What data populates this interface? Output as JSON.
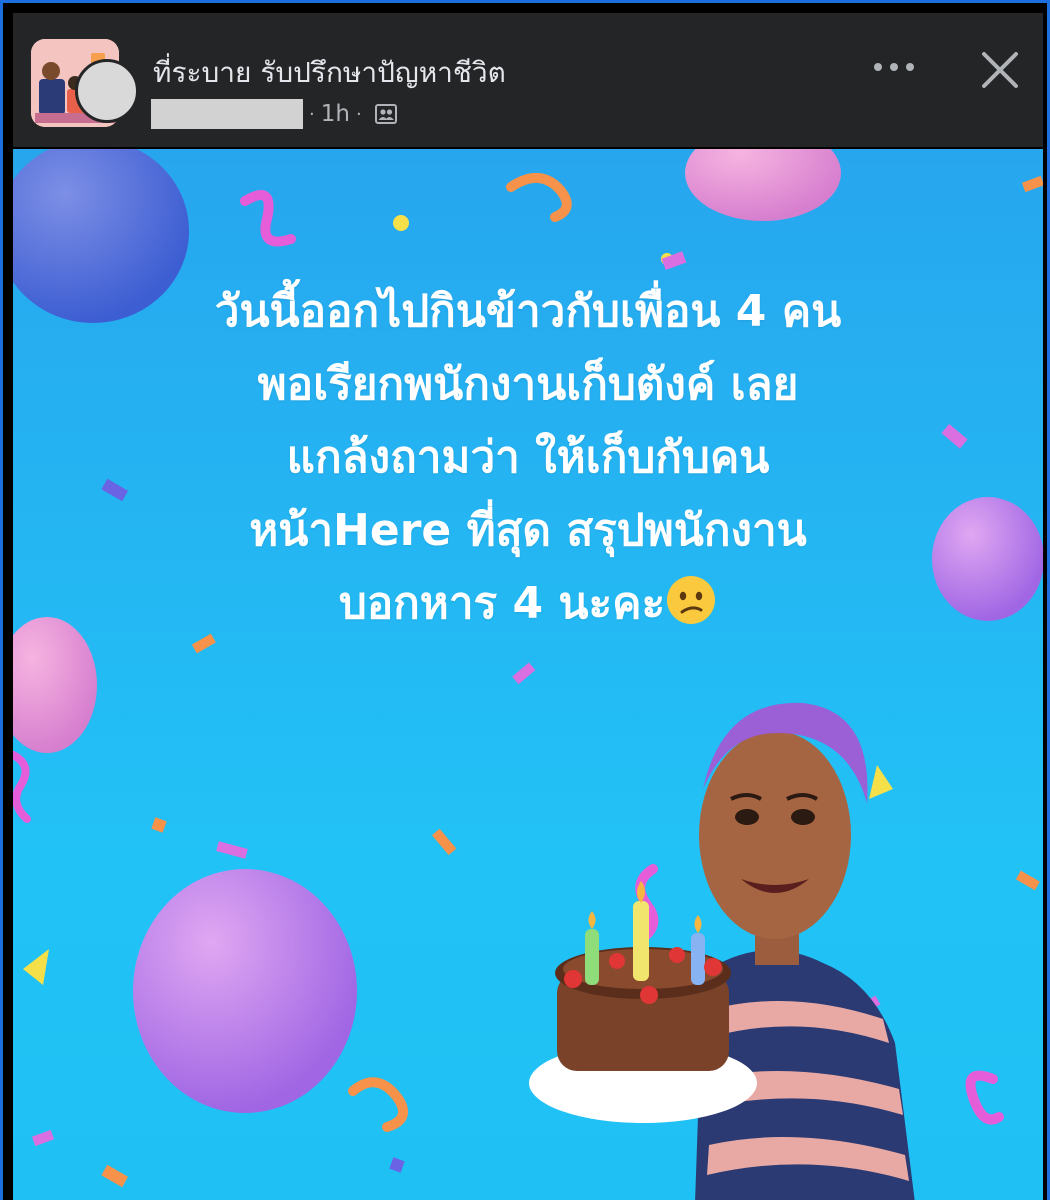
{
  "header": {
    "group_name": "ที่ระบาย รับปรึกษาปัญหาชีวิต",
    "time_ago": "1h",
    "separator": "·"
  },
  "post": {
    "lines": [
      "วันนี้ออกไปกินข้าวกับเพื่อน 4 คน",
      "พอเรียกพนักงานเก็บตังค์ เลย",
      "แกล้งถามว่า ให้เก็บกับคน",
      "หน้าHere ที่สุด สรุปพนักงาน",
      "บอกหาร 4 นะคะ"
    ],
    "background_color": "#24b7f3"
  },
  "icons": {
    "more": "more-options-icon",
    "close": "close-icon",
    "audience": "group-audience-icon",
    "emoji": "confused-face-emoji"
  }
}
